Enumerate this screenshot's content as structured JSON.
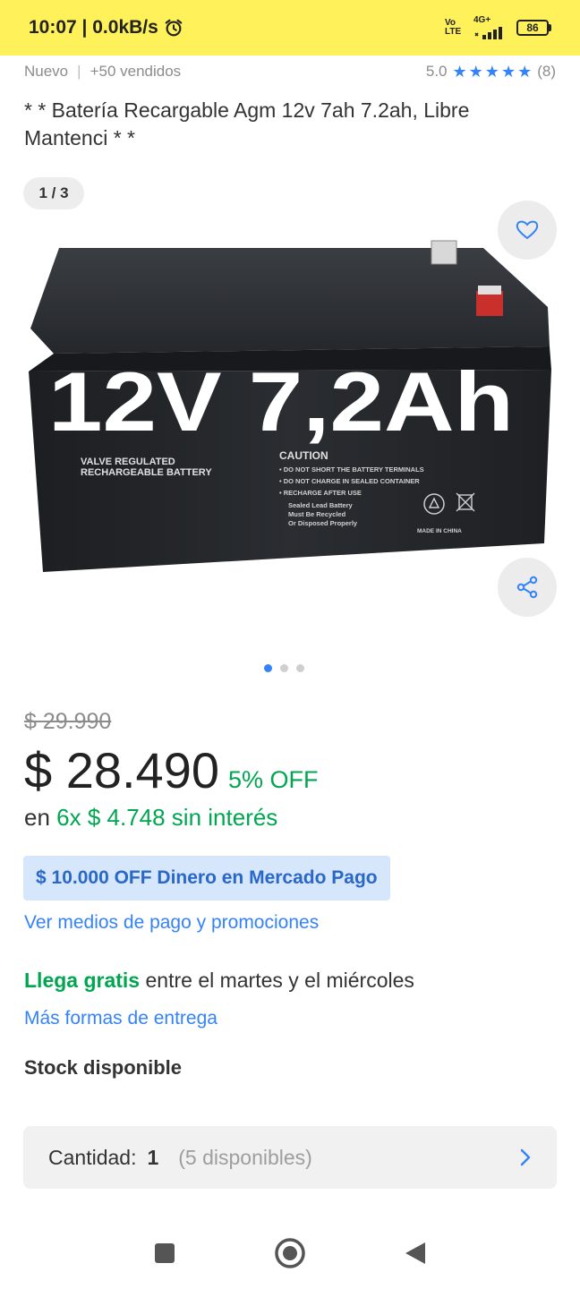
{
  "status_bar": {
    "time_speed": "10:07 | 0.0kB/s",
    "net_top": "Vo LTE",
    "net_gen": "4G+",
    "battery": "86",
    "background": "#fff159"
  },
  "product": {
    "condition": "Nuevo",
    "sold": "+50 vendidos",
    "rating_value": "5.0",
    "rating_count": "(8)",
    "stars": 5,
    "title": "* * Batería Recargable Agm 12v 7ah 7.2ah, Libre Mantenci * *",
    "image_counter": "1 / 3",
    "image_index": 1,
    "image_total": 3
  },
  "battery_image": {
    "big_label": "12V 7,2Ah",
    "side_label_1": "VALVE REGULATED",
    "side_label_2": "RECHARGEABLE BATTERY",
    "caution_title": "CAUTION",
    "caution_1": "• DO NOT SHORT THE BATTERY TERMINALS",
    "caution_2": "• DO NOT CHARGE IN SEALED CONTAINER",
    "caution_3": "• RECHARGE AFTER USE",
    "recycle_1": "Sealed Lead Battery",
    "recycle_2": "Must Be Recycled",
    "recycle_3": "Or Disposed Properly",
    "origin": "MADE IN CHINA"
  },
  "pricing": {
    "old_price": "$ 29.990",
    "price": "$ 28.490",
    "discount": "5% OFF",
    "installments_prefix": "en",
    "installments_value": "6x $ 4.748 sin interés",
    "promo_badge": "$ 10.000 OFF Dinero en Mercado Pago",
    "payment_link": "Ver medios de pago y promociones"
  },
  "shipping": {
    "free_label": "Llega gratis",
    "window": " entre el martes y el miércoles",
    "more_link": "Más formas de entrega"
  },
  "stock": {
    "label": "Stock disponible",
    "quantity_label": "Cantidad:",
    "quantity_value": "1",
    "available": "(5 disponibles)"
  },
  "colors": {
    "accent_blue": "#3483fa",
    "green": "#00a650",
    "promo_bg": "#d6e6fb"
  },
  "icons": [
    "alarm-icon",
    "signal-icon",
    "battery-icon",
    "star-icon",
    "heart-icon",
    "share-icon",
    "chevron-right-icon",
    "nav-recents-icon",
    "nav-home-icon",
    "nav-back-icon"
  ]
}
